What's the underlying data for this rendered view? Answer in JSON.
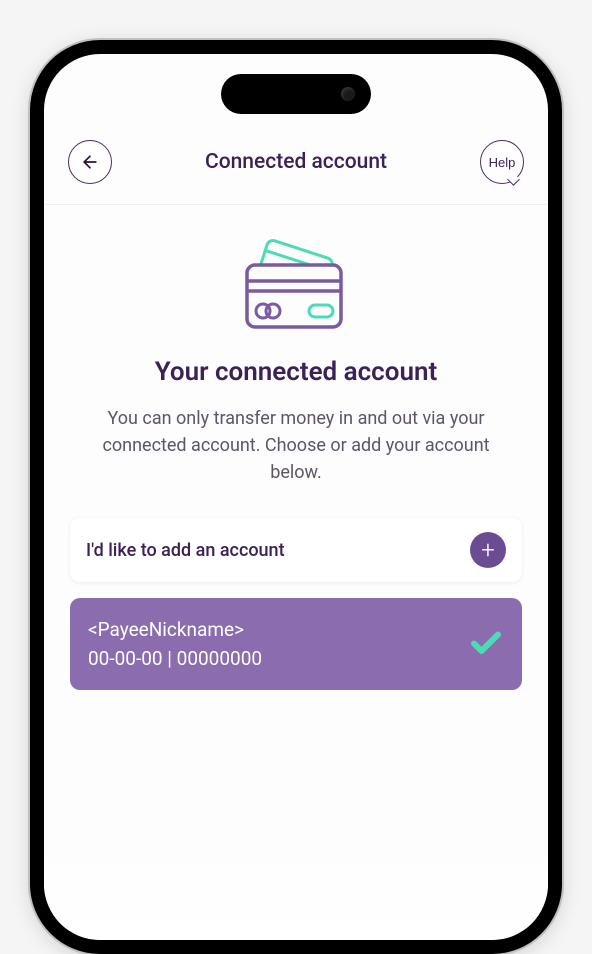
{
  "header": {
    "title": "Connected account",
    "help_label": "Help"
  },
  "main": {
    "title": "Your connected account",
    "description": "You can only transfer money in and out via your connected account. Choose or add your account below.",
    "add_account_label": "I'd like to add an account",
    "account": {
      "nickname": "<PayeeNickname>",
      "details": "00-00-00 | 00000000",
      "selected": true
    }
  },
  "colors": {
    "brand_purple": "#3c2157",
    "accent_purple": "#8a6caf",
    "badge_purple": "#6b4c93",
    "teal": "#4ddbb6"
  }
}
